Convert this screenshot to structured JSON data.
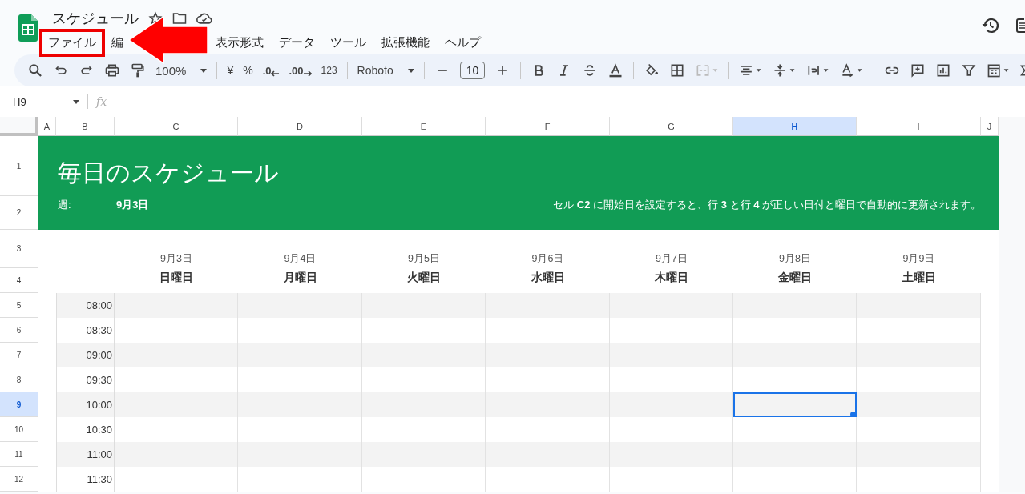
{
  "doc": {
    "title": "スケジュール"
  },
  "menus": [
    {
      "label": "ファイル",
      "highlighted": true
    },
    {
      "label": "編",
      "highlighted": false
    },
    {
      "label": "表示形式",
      "highlighted": false
    },
    {
      "label": "データ",
      "highlighted": false
    },
    {
      "label": "ツール",
      "highlighted": false
    },
    {
      "label": "拡張機能",
      "highlighted": false
    },
    {
      "label": "ヘルプ",
      "highlighted": false
    }
  ],
  "toolbar": {
    "zoom": "100%",
    "currency": "¥",
    "percent": "%",
    "decrease_decimal": ".0",
    "increase_decimal": ".00",
    "number_format": "123",
    "font": "Roboto",
    "font_size": "10"
  },
  "formula_bar": {
    "cell_ref": "H9",
    "fx": "fx"
  },
  "columns": [
    {
      "label": "A",
      "selected": false
    },
    {
      "label": "B",
      "selected": false
    },
    {
      "label": "C",
      "selected": false
    },
    {
      "label": "D",
      "selected": false
    },
    {
      "label": "E",
      "selected": false
    },
    {
      "label": "F",
      "selected": false
    },
    {
      "label": "G",
      "selected": false
    },
    {
      "label": "H",
      "selected": true
    },
    {
      "label": "I",
      "selected": false
    },
    {
      "label": "J",
      "selected": false
    }
  ],
  "rows": [
    {
      "label": "1",
      "selected": false
    },
    {
      "label": "2",
      "selected": false
    },
    {
      "label": "3",
      "selected": false
    },
    {
      "label": "4",
      "selected": false
    },
    {
      "label": "5",
      "selected": false
    },
    {
      "label": "6",
      "selected": false
    },
    {
      "label": "7",
      "selected": false
    },
    {
      "label": "8",
      "selected": false
    },
    {
      "label": "9",
      "selected": true
    },
    {
      "label": "10",
      "selected": false
    },
    {
      "label": "11",
      "selected": false
    },
    {
      "label": "12",
      "selected": false
    }
  ],
  "banner": {
    "title": "毎日のスケジュール",
    "week_label": "週:",
    "week_value": "9月3日",
    "note": "セル **C2** に開始日を設定すると、行 **3** と行 **4** が正しい日付と曜日で自動的に更新されます。"
  },
  "days": [
    {
      "date": "9月3日",
      "weekday": "日曜日"
    },
    {
      "date": "9月4日",
      "weekday": "月曜日"
    },
    {
      "date": "9月5日",
      "weekday": "火曜日"
    },
    {
      "date": "9月6日",
      "weekday": "水曜日"
    },
    {
      "date": "9月7日",
      "weekday": "木曜日"
    },
    {
      "date": "9月8日",
      "weekday": "金曜日"
    },
    {
      "date": "9月9日",
      "weekday": "土曜日"
    }
  ],
  "times": [
    "08:00",
    "08:30",
    "09:00",
    "09:30",
    "10:00",
    "10:30",
    "11:00",
    "11:30"
  ]
}
